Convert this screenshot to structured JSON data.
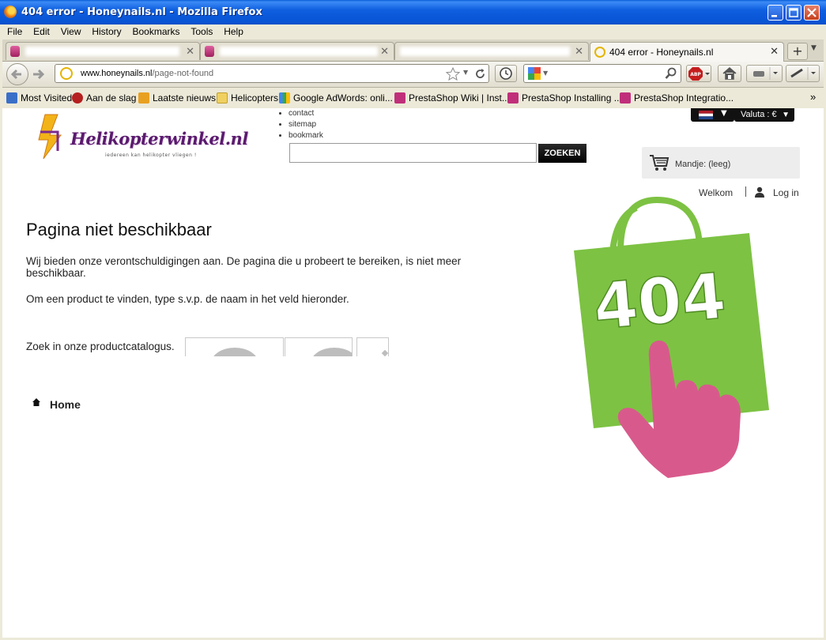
{
  "window": {
    "title": "404 error - Honeynails.nl - Mozilla Firefox"
  },
  "menu": [
    "File",
    "Edit",
    "View",
    "History",
    "Bookmarks",
    "Tools",
    "Help"
  ],
  "tabs": [
    {
      "label": "",
      "active": false
    },
    {
      "label": "",
      "active": false
    },
    {
      "label": "",
      "active": false
    },
    {
      "label": "404 error - Honeynails.nl",
      "active": true
    }
  ],
  "tabs_new_label": "+",
  "navbar": {
    "url_domain": "www.honeynails.nl",
    "url_path": "/page-not-found",
    "search_value": ""
  },
  "bookmarks": [
    {
      "label": "Most Visited",
      "icon": "most-visited-icon",
      "color": "#3A6FC8"
    },
    {
      "label": "Aan de slag",
      "icon": "firefox-icon",
      "color": "#B52020"
    },
    {
      "label": "Laatste nieuws",
      "icon": "rss-icon",
      "color": "#E8A020"
    },
    {
      "label": "Helicopters",
      "icon": "folder-icon",
      "color": "#F0D060"
    },
    {
      "label": "Google AdWords: onli...",
      "icon": "google-icon",
      "color": "#4285F4"
    },
    {
      "label": "PrestaShop Wiki | Inst...",
      "icon": "prestashop-icon",
      "color": "#C0307A"
    },
    {
      "label": "PrestaShop Installing ...",
      "icon": "prestashop-icon",
      "color": "#C0307A"
    },
    {
      "label": "PrestaShop Integratio...",
      "icon": "prestashop-icon",
      "color": "#C0307A"
    }
  ],
  "bookmarks_overflow": "»",
  "site": {
    "logo_text": "Helikopterwinkel.nl",
    "logo_tagline": "iedereen kan helikopter vliegen !",
    "top_links": [
      "contact",
      "sitemap",
      "bookmark"
    ],
    "search_button": "ZOEKEN",
    "currency_label": "Valuta : €",
    "cart_label": "Mandje: (leeg)",
    "welcome": "Welkom",
    "login": "Log in",
    "page_title": "Pagina niet beschikbaar",
    "paragraph1": "Wij bieden onze verontschuldigingen aan. De pagina die u probeert te bereiken, is niet meer beschikbaar.",
    "paragraph2": "Om een product te vinden, type s.v.p. de naam in het veld hieronder.",
    "catalog_label": "Zoek in onze productcatalogus.",
    "home_link": "Home",
    "error_code": "404"
  },
  "colors": {
    "bag_green": "#7DC243",
    "hand_pink": "#D85A8C",
    "logo_purple": "#5B1A6E",
    "xp_blue": "#0A5FD8"
  }
}
